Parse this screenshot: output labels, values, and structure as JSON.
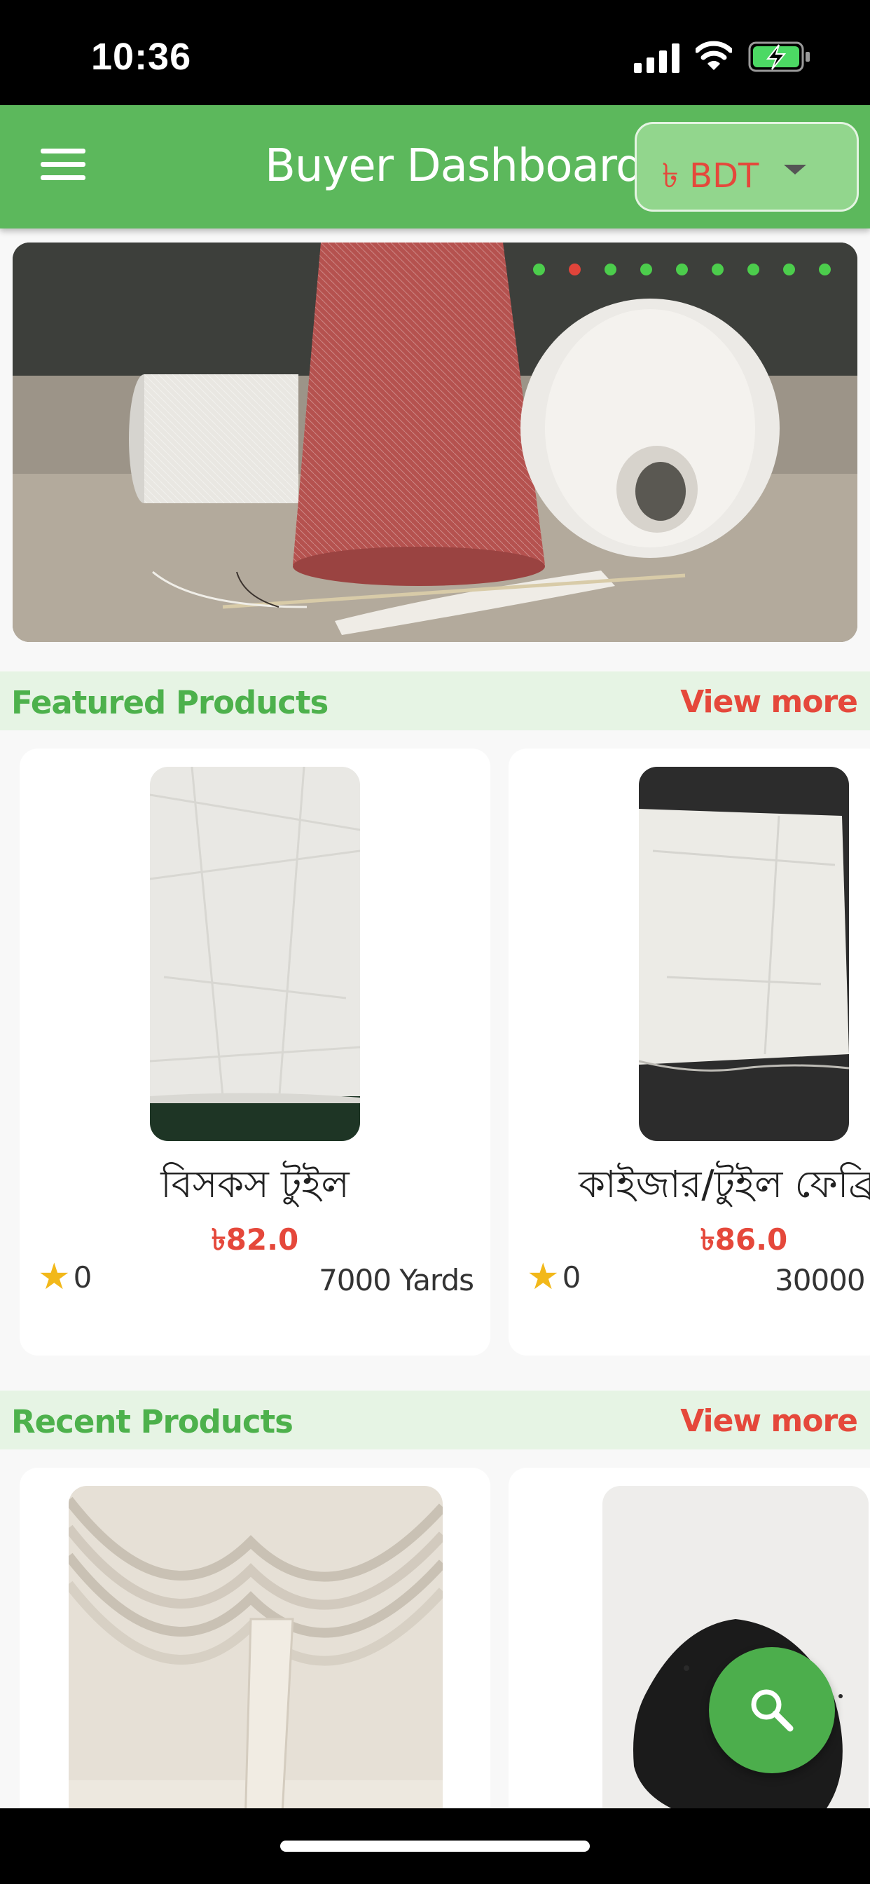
{
  "status_bar": {
    "time": "10:36"
  },
  "header": {
    "title": "Buyer Dashboard",
    "currency": "৳ BDT"
  },
  "banner": {
    "slide_count": 9,
    "active_slide": 2
  },
  "featured": {
    "title": "Featured Products",
    "view_more": "View more",
    "products": [
      {
        "name": "বিসকস টুইল",
        "price": "৳82.0",
        "rating": "0",
        "quantity": "7000 Yards"
      },
      {
        "name": "কাইজার/টুইল ফেব্রি",
        "price": "৳86.0",
        "rating": "0",
        "quantity": "30000"
      }
    ]
  },
  "recent": {
    "title": "Recent Products",
    "view_more": "View more"
  },
  "colors": {
    "primary": "#5cb85c",
    "accent_red": "#e5483b",
    "section_bg": "#e6f4e4",
    "star": "#f2b81a"
  },
  "icons": {
    "menu": "menu-icon",
    "dropdown": "chevron-down-icon",
    "search": "search-icon",
    "star": "star-icon"
  }
}
